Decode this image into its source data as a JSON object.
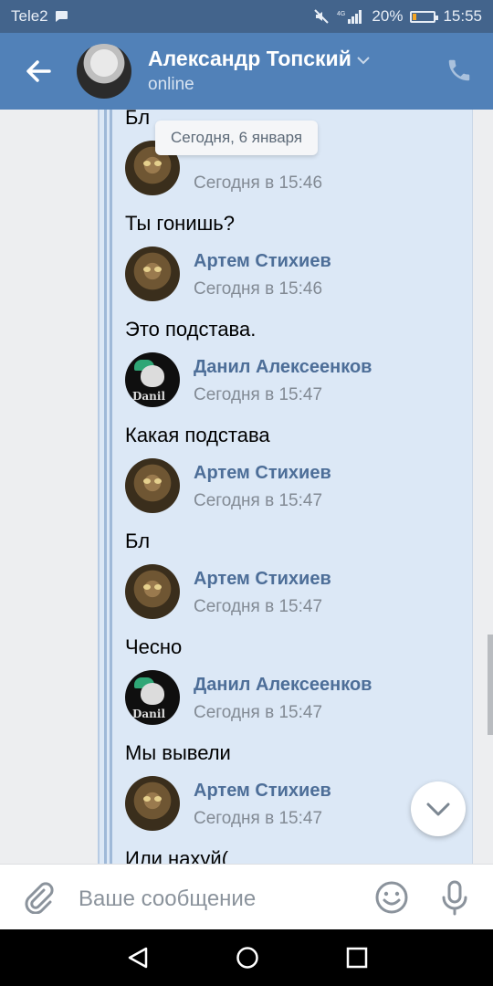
{
  "statusbar": {
    "carrier": "Tele2",
    "battery": "20%",
    "time": "15:55",
    "battery_level": 0.2
  },
  "header": {
    "name": "Александр Топский",
    "status": "online"
  },
  "chat": {
    "date_pill": "Сегодня, 6 января",
    "top_partial_text": "Бл",
    "first_partial_time": "Сегодня в 15:46",
    "messages": [
      {
        "text": "Ты гонишь?",
        "author": "Артем Стихиев",
        "time": "Сегодня в 15:46",
        "avatar": "cat"
      },
      {
        "text": "Это подстава.",
        "author": "Данил Алексеенков",
        "time": "Сегодня в 15:47",
        "avatar": "danil"
      },
      {
        "text": "Какая подстава",
        "author": "Артем Стихиев",
        "time": "Сегодня в 15:47",
        "avatar": "cat"
      },
      {
        "text": "Бл",
        "author": "Артем Стихиев",
        "time": "Сегодня в 15:47",
        "avatar": "cat"
      },
      {
        "text": "Чесно",
        "author": "Данил Алексеенков",
        "time": "Сегодня в 15:47",
        "avatar": "danil"
      },
      {
        "text": "Мы вывели",
        "author": "Артем Стихиев",
        "time": "Сегодня в 15:47",
        "avatar": "cat"
      },
      {
        "text": "Или нахуй(",
        "author": "",
        "time": "",
        "avatar": ""
      }
    ],
    "avatar_label_danil": "Danil"
  },
  "inputbar": {
    "placeholder": "Ваше сообщение"
  },
  "icons": {
    "back": "arrow-left-icon",
    "phone": "phone-icon",
    "attach": "paperclip-icon",
    "smile": "smile-icon",
    "mic": "microphone-icon",
    "scroll": "chevron-down-icon"
  },
  "colors": {
    "header": "#5181b8",
    "statusbar": "#43648c",
    "forward_bg": "#dce8f6",
    "author": "#4d6e98"
  }
}
